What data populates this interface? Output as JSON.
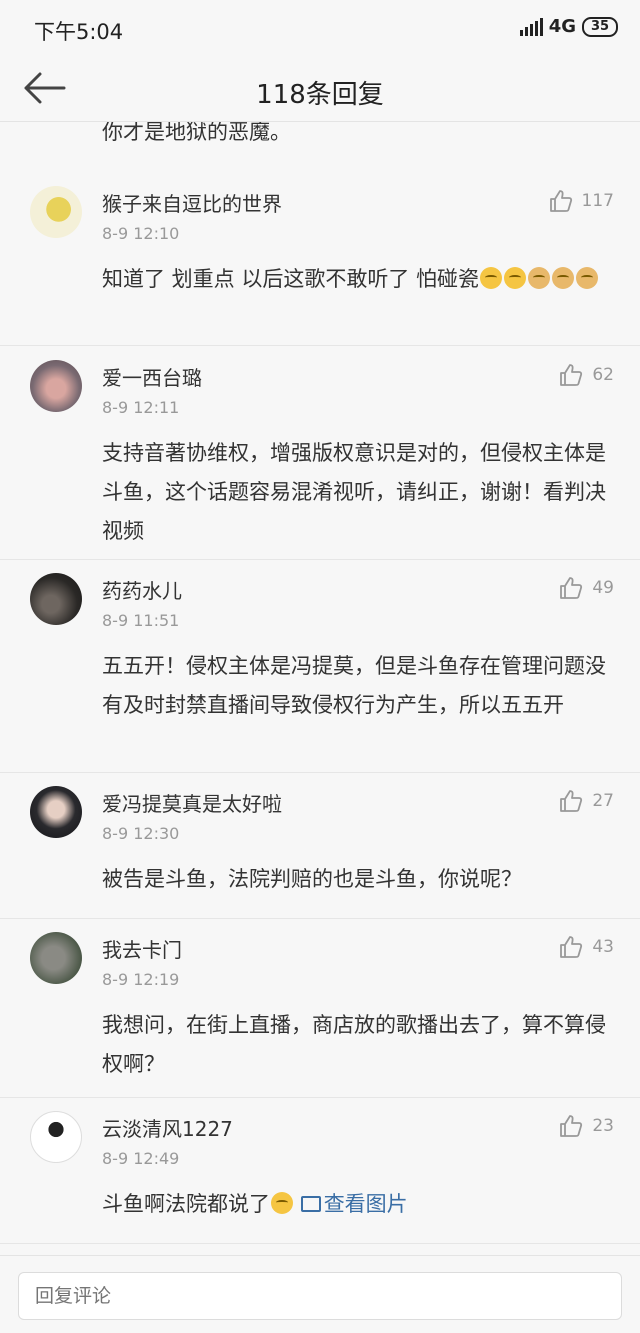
{
  "status_bar": {
    "time": "下午5:04",
    "network": "4G",
    "battery": "35"
  },
  "nav": {
    "title": "118条回复"
  },
  "cut_off_text": "你才是地狱的恶魔。",
  "comments": [
    {
      "user": "猴子来自逗比的世界",
      "time": "8-9 12:10",
      "likes": "117",
      "text": "知道了 划重点 以后这歌不敢听了 怕碰瓷"
    },
    {
      "user": "爱一西台璐",
      "time": "8-9 12:11",
      "likes": "62",
      "text": "支持音著协维权，增强版权意识是对的，但侵权主体是斗鱼，这个话题容易混淆视听，请纠正，谢谢！看判决视频"
    },
    {
      "user": "药药水儿",
      "time": "8-9 11:51",
      "likes": "49",
      "text": "五五开！侵权主体是冯提莫，但是斗鱼存在管理问题没有及时封禁直播间导致侵权行为产生，所以五五开"
    },
    {
      "user": "爱冯提莫真是太好啦",
      "time": "8-9 12:30",
      "likes": "27",
      "text": "被告是斗鱼，法院判赔的也是斗鱼，你说呢？"
    },
    {
      "user": "我去卡门",
      "time": "8-9 12:19",
      "likes": "43",
      "text": "我想问，在街上直播，商店放的歌播出去了，算不算侵权啊？"
    },
    {
      "user": "云淡清风1227",
      "time": "8-9 12:49",
      "likes": "23",
      "text": "斗鱼啊法院都说了",
      "link": "查看图片"
    }
  ],
  "reply": {
    "placeholder": "回复评论"
  }
}
